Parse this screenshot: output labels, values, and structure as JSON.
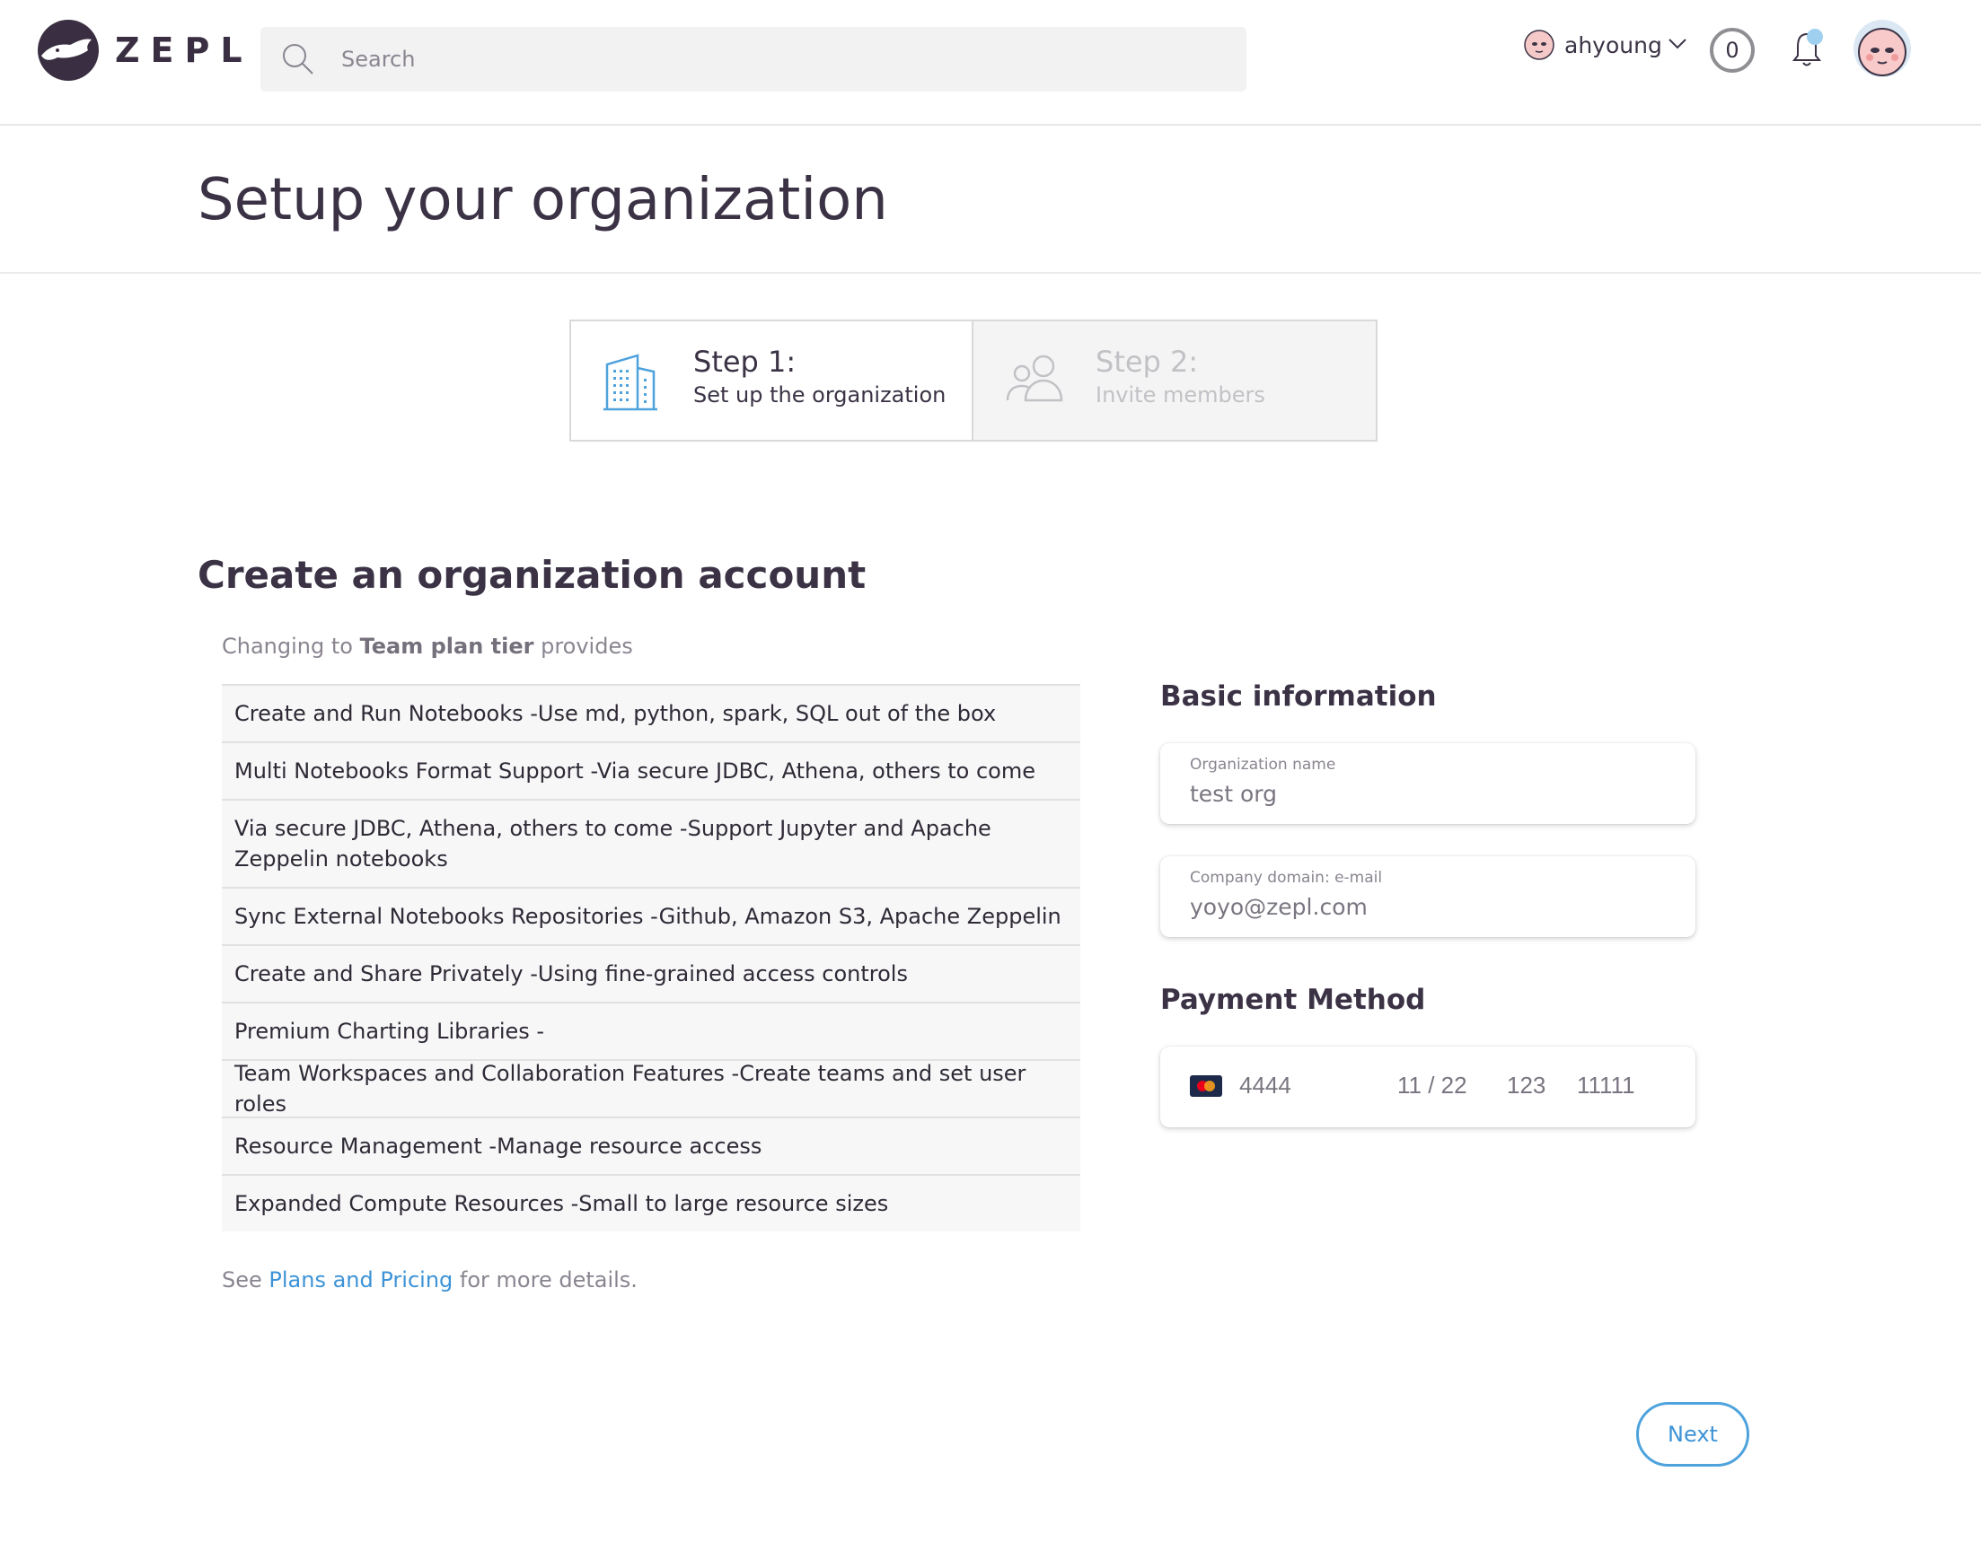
{
  "header": {
    "brand": "ZEPL",
    "search_placeholder": "Search",
    "username": "ahyoung",
    "count": "0",
    "icons": {
      "logo": "zepl-whale-logo",
      "search": "search-icon",
      "chevron": "chevron-down-icon",
      "bell": "bell-icon"
    }
  },
  "page": {
    "title": "Setup your organization"
  },
  "stepper": {
    "steps": [
      {
        "title": "Step 1:",
        "subtitle": "Set up the organization",
        "icon": "building-icon",
        "state": "active"
      },
      {
        "title": "Step 2:",
        "subtitle": "Invite members",
        "icon": "users-icon",
        "state": "inactive"
      }
    ]
  },
  "plan": {
    "heading": "Create an organization account",
    "intro_prefix": "Changing to ",
    "intro_bold": "Team plan tier",
    "intro_suffix": " provides",
    "features": [
      "Create and Run Notebooks -Use md, python, spark, SQL out of the box",
      "Multi Notebooks Format Support -Via secure JDBC, Athena, others to come",
      "Via secure JDBC, Athena, others to come -Support Jupyter and Apache Zeppelin notebooks",
      "Sync External Notebooks Repositories -Github, Amazon S3, Apache Zeppelin",
      "Create and Share Privately -Using fine-grained access controls",
      "Premium Charting Libraries -",
      "Team Workspaces and Collaboration Features -Create teams and set user roles",
      "Resource Management -Manage resource access",
      "Expanded Compute Resources -Small to large resource sizes"
    ],
    "footnote_prefix": "See ",
    "footnote_link": "Plans and Pricing",
    "footnote_suffix": " for more details."
  },
  "form": {
    "basic_title": "Basic information",
    "org_label": "Organization name",
    "org_value": "test org",
    "domain_label": "Company domain: e-mail",
    "domain_value": "yoyo@zepl.com",
    "payment_title": "Payment Method",
    "card": {
      "number": "4444",
      "expiry": "11 / 22",
      "cvc": "123",
      "zip": "11111",
      "brand_icon": "mastercard-icon"
    },
    "next_label": "Next"
  },
  "colors": {
    "text": "#3b3345",
    "muted": "#8a8590",
    "accent": "#3d93d6",
    "step_icon": "#4ea3dd"
  }
}
